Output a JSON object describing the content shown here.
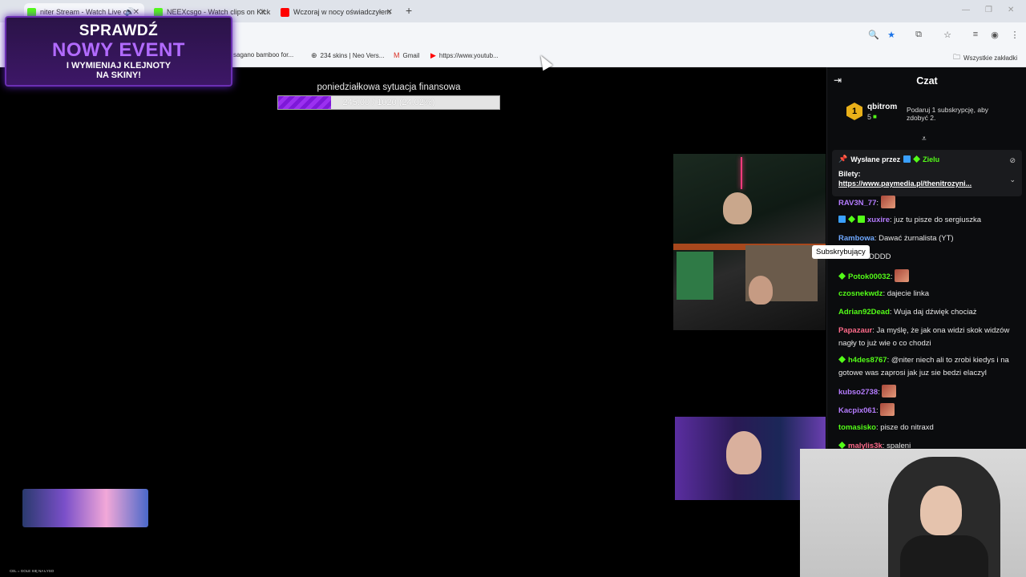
{
  "browser": {
    "tabs": [
      {
        "title": "niter Stream - Watch Live o",
        "active": true,
        "favicon_color": "#53fc18"
      },
      {
        "title": "NEEXcsgo - Watch clips on Kick",
        "active": false,
        "favicon_color": "#53fc18"
      },
      {
        "title": "Wczoraj w nocy oświadczyłem",
        "active": false,
        "favicon_color": "#ff0000"
      }
    ],
    "bookmarks": [
      {
        "label": "sagano bamboo for...",
        "icon": "image-icon"
      },
      {
        "label": "234 skins | Neo Vers...",
        "icon": "globe-icon"
      },
      {
        "label": "Gmail",
        "icon": "gmail-icon"
      },
      {
        "label": "https://www.youtub...",
        "icon": "youtube-icon"
      }
    ],
    "all_bookmarks_label": "Wszystkie zakładki"
  },
  "event_overlay": {
    "line1": "SPRAWDŹ",
    "line2": "NOWY EVENT",
    "line3": "I WYMIENIAJ KLEJNOTY",
    "line4": "NA SKINY!"
  },
  "goal": {
    "title": "poniedziałkowa sytuacja finansowa",
    "text": "245.00 / 1020 (24.02%)",
    "progress": 0.2402
  },
  "bottom_note": "CEL = GOLE SIĘ NA ŁYSO",
  "chat": {
    "title": "Czat",
    "leader": {
      "rank": "1",
      "name": "qbitrom",
      "count": "5",
      "hint": "Podaruj 1 subskrypcję, aby zdobyć 2."
    },
    "pinned": {
      "sent_by_label": "Wysłane przez",
      "sent_by_user": "Zielu",
      "label": "Bilety:",
      "link": "https://www.paymedia.pl/thenitrozyni..."
    },
    "tooltip": "Subskrybujący",
    "messages": [
      {
        "user": "RAV3N_77",
        "color": "#b57cff",
        "text": "",
        "emote": true,
        "badges": []
      },
      {
        "user": "xuxire",
        "color": "#b57cff",
        "text": "juz tu pisze do sergiuszka",
        "emote": false,
        "badges": [
          "b-blue",
          "b-green",
          "b-gift"
        ]
      },
      {
        "user": "Rambowa",
        "color": "#6fa8ff",
        "text": "Dawać żurnalista (YT)",
        "emote": false,
        "badges": []
      },
      {
        "user": "xuxire",
        "color": "#b57cff",
        "text": "xDDDD",
        "emote": false,
        "badges": []
      },
      {
        "user": "Potok00032",
        "color": "#53fc18",
        "text": "",
        "emote": true,
        "badges": [
          "b-green"
        ]
      },
      {
        "user": "czosnekwdz",
        "color": "#53fc18",
        "text": "dajecie linka",
        "emote": false,
        "badges": []
      },
      {
        "user": "Adrian92Dead",
        "color": "#53fc18",
        "text": "Wuja daj dźwięk chociaż",
        "emote": false,
        "badges": []
      },
      {
        "user": "Papazaur",
        "color": "#ff6b8a",
        "text": "Ja myślę, że jak ona widzi skok widzów nagły to już wie o co chodzi",
        "emote": false,
        "badges": []
      },
      {
        "user": "h4des8767",
        "color": "#53fc18",
        "text": "@niter niech ali to zrobi kiedys i na gotowe was zaprosi jak juz sie bedzi elaczyl",
        "emote": false,
        "badges": [
          "b-green"
        ]
      },
      {
        "user": "kubso2738",
        "color": "#b57cff",
        "text": "",
        "emote": true,
        "badges": []
      },
      {
        "user": "Kacpix061",
        "color": "#b57cff",
        "text": "",
        "emote": true,
        "badges": []
      },
      {
        "user": "tomasisko",
        "color": "#53fc18",
        "text": "pisze do nitraxd",
        "emote": false,
        "badges": []
      },
      {
        "user": "malylis3k",
        "color": "#ff6b8a",
        "text": "spaleni",
        "emote": false,
        "badges": [
          "b-green"
        ]
      }
    ]
  }
}
